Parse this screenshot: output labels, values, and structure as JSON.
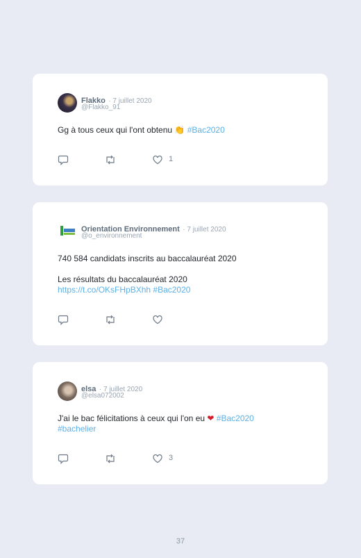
{
  "tweets": [
    {
      "name": "Flakko",
      "date": "· 7 juillet 2020",
      "handle": "@Flakko_91",
      "text_line1": "Gg à tous ceux qui l'ont obtenu",
      "emoji": "👏",
      "hashtags_line1": "#Bac2020",
      "likes": "1"
    },
    {
      "name": "Orientation Environnement",
      "date": "· 7 juillet 2020",
      "handle": "@o_environnement",
      "text_line1": "740 584 candidats inscrits au baccalauréat 2020",
      "text_line2": "Les résultats du baccalauréat 2020",
      "link": "https://t.co/OKsFHpBXhh",
      "hashtags_line3": "#Bac2020",
      "likes": ""
    },
    {
      "name": "elsa",
      "date": "· 7 juillet 2020",
      "handle": "@elsa072002",
      "text_line1": "J'ai le bac félicitations à ceux qui l'on eu",
      "emoji": "❤",
      "hashtags_line1": "#Bac2020",
      "hashtags_line2": "#bachelier",
      "likes": "3"
    }
  ],
  "page_number": "37",
  "icons": [
    "reply-icon",
    "retweet-icon",
    "like-icon"
  ],
  "colors": {
    "background": "#e8ebf3",
    "card": "#ffffff",
    "hashtag": "#5bb0e6",
    "name": "#5d6b7a"
  }
}
